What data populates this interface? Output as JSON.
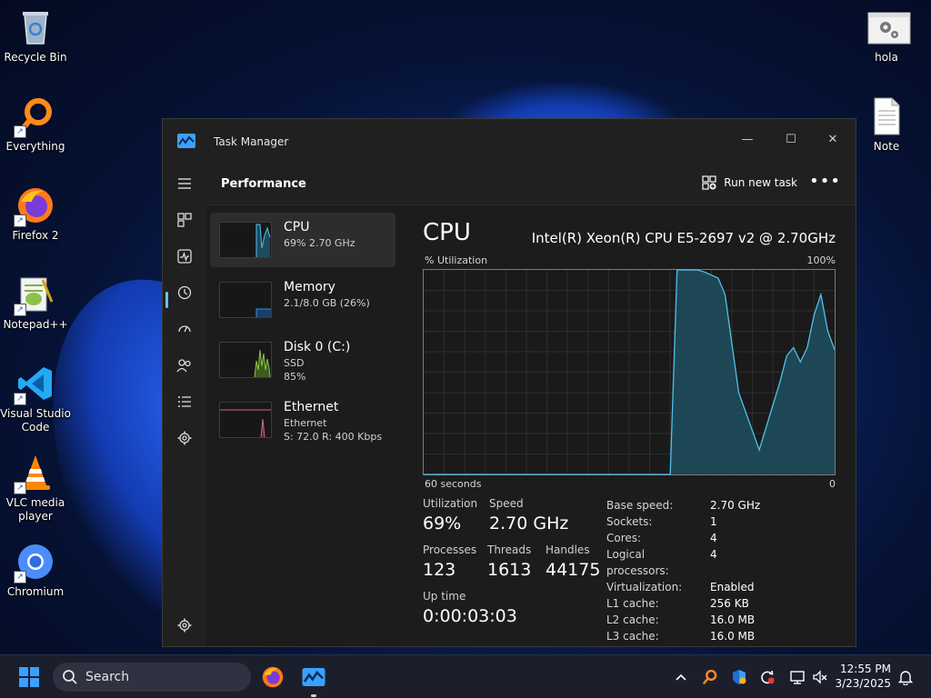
{
  "desktop": {
    "icons": [
      {
        "label": "Recycle Bin"
      },
      {
        "label": "Everything"
      },
      {
        "label": "Firefox 2"
      },
      {
        "label": "Notepad++"
      },
      {
        "label": "Visual Studio Code"
      },
      {
        "label": "VLC media player"
      },
      {
        "label": "Chromium"
      },
      {
        "label": "hola"
      },
      {
        "label": "Note"
      }
    ]
  },
  "window": {
    "title": "Task Manager",
    "controls": {
      "minimize": "—",
      "maximize": "☐",
      "close": "✕"
    }
  },
  "header": {
    "title": "Performance",
    "run_new_task": "Run new task",
    "more": "•••"
  },
  "nav": [
    "hamburger-icon",
    "processes-icon",
    "performance-icon",
    "app-history-icon",
    "startup-apps-icon",
    "users-icon",
    "details-icon",
    "services-icon",
    "settings-icon"
  ],
  "perf_list": [
    {
      "name": "CPU",
      "line1": "69% 2.70 GHz",
      "line2": "",
      "color": "#4fc1e9"
    },
    {
      "name": "Memory",
      "line1": "2.1/8.0 GB (26%)",
      "line2": "",
      "color": "#3a8ee6"
    },
    {
      "name": "Disk 0 (C:)",
      "line1": "SSD",
      "line2": "85%",
      "color": "#8bc34a"
    },
    {
      "name": "Ethernet",
      "line1": "Ethernet",
      "line2": "S: 72.0  R: 400 Kbps",
      "color": "#d9677b"
    }
  ],
  "cpu": {
    "title": "CPU",
    "model": "Intel(R) Xeon(R) CPU E5-2697 v2 @ 2.70GHz",
    "graph_label_left": "% Utilization",
    "graph_label_right": "100%",
    "graph_foot_left": "60 seconds",
    "graph_foot_right": "0",
    "utilization_label": "Utilization",
    "utilization": "69%",
    "speed_label": "Speed",
    "speed": "2.70 GHz",
    "processes_label": "Processes",
    "processes": "123",
    "threads_label": "Threads",
    "threads": "1613",
    "handles_label": "Handles",
    "handles": "44175",
    "uptime_label": "Up time",
    "uptime": "0:00:03:03",
    "specs": [
      {
        "k": "Base speed:",
        "v": "2.70 GHz"
      },
      {
        "k": "Sockets:",
        "v": "1"
      },
      {
        "k": "Cores:",
        "v": "4"
      },
      {
        "k": "Logical processors:",
        "v": "4"
      },
      {
        "k": "Virtualization:",
        "v": "Enabled"
      },
      {
        "k": "L1 cache:",
        "v": "256 KB"
      },
      {
        "k": "L2 cache:",
        "v": "16.0 MB"
      },
      {
        "k": "L3 cache:",
        "v": "16.0 MB"
      }
    ]
  },
  "chart_data": {
    "type": "area",
    "x": [
      0,
      5,
      10,
      15,
      20,
      25,
      30,
      35,
      36,
      37,
      40,
      41,
      43,
      44,
      46,
      49,
      52,
      53,
      54,
      55,
      56,
      57,
      58,
      59,
      60
    ],
    "values": [
      0,
      0,
      0,
      0,
      0,
      0,
      0,
      0,
      0,
      100,
      100,
      99,
      96,
      88,
      40,
      12,
      45,
      58,
      62,
      55,
      62,
      78,
      88,
      70,
      61
    ],
    "xlim": [
      0,
      60
    ],
    "ylim": [
      0,
      100
    ],
    "grid": true,
    "color": "#4fc1e9"
  },
  "taskbar": {
    "search_placeholder": "Search",
    "apps": [
      "firefox-icon",
      "task-manager-icon"
    ],
    "tray": [
      "chevron-up-icon",
      "everything-icon",
      "security-icon",
      "sync-icon",
      "network-icon",
      "volume-muted-icon"
    ],
    "time": "12:55 PM",
    "date": "3/23/2025"
  }
}
